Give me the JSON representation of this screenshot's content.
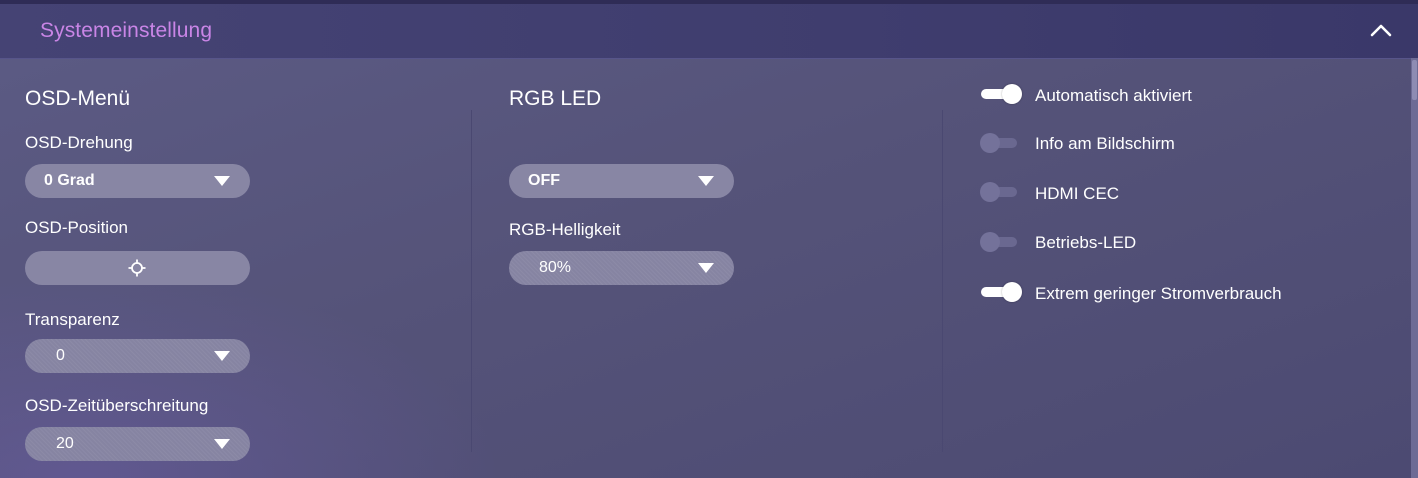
{
  "header": {
    "title": "Systemeinstellung",
    "collapse_icon": "chevron-up-icon"
  },
  "osd_menu": {
    "title": "OSD-Menü",
    "rotation": {
      "label": "OSD-Drehung",
      "value": "0 Grad"
    },
    "position": {
      "label": "OSD-Position",
      "icon": "crosshair-icon"
    },
    "transparency": {
      "label": "Transparenz",
      "value": "0"
    },
    "timeout": {
      "label": "OSD-Zeitüberschreitung",
      "value": "20"
    }
  },
  "rgb_led": {
    "title": "RGB LED",
    "mode": {
      "value": "OFF"
    },
    "brightness": {
      "label": "RGB-Helligkeit",
      "value": "80%"
    }
  },
  "toggles": [
    {
      "label": "Automatisch aktiviert",
      "on": true
    },
    {
      "label": "Info am Bildschirm",
      "on": false
    },
    {
      "label": "HDMI CEC",
      "on": false
    },
    {
      "label": "Betriebs-LED",
      "on": false
    },
    {
      "label": "Extrem geringer Stromverbrauch",
      "on": true
    }
  ],
  "colors": {
    "title_accent": "#c985e6",
    "background": "#555379",
    "dropdown": "#8886a4"
  }
}
